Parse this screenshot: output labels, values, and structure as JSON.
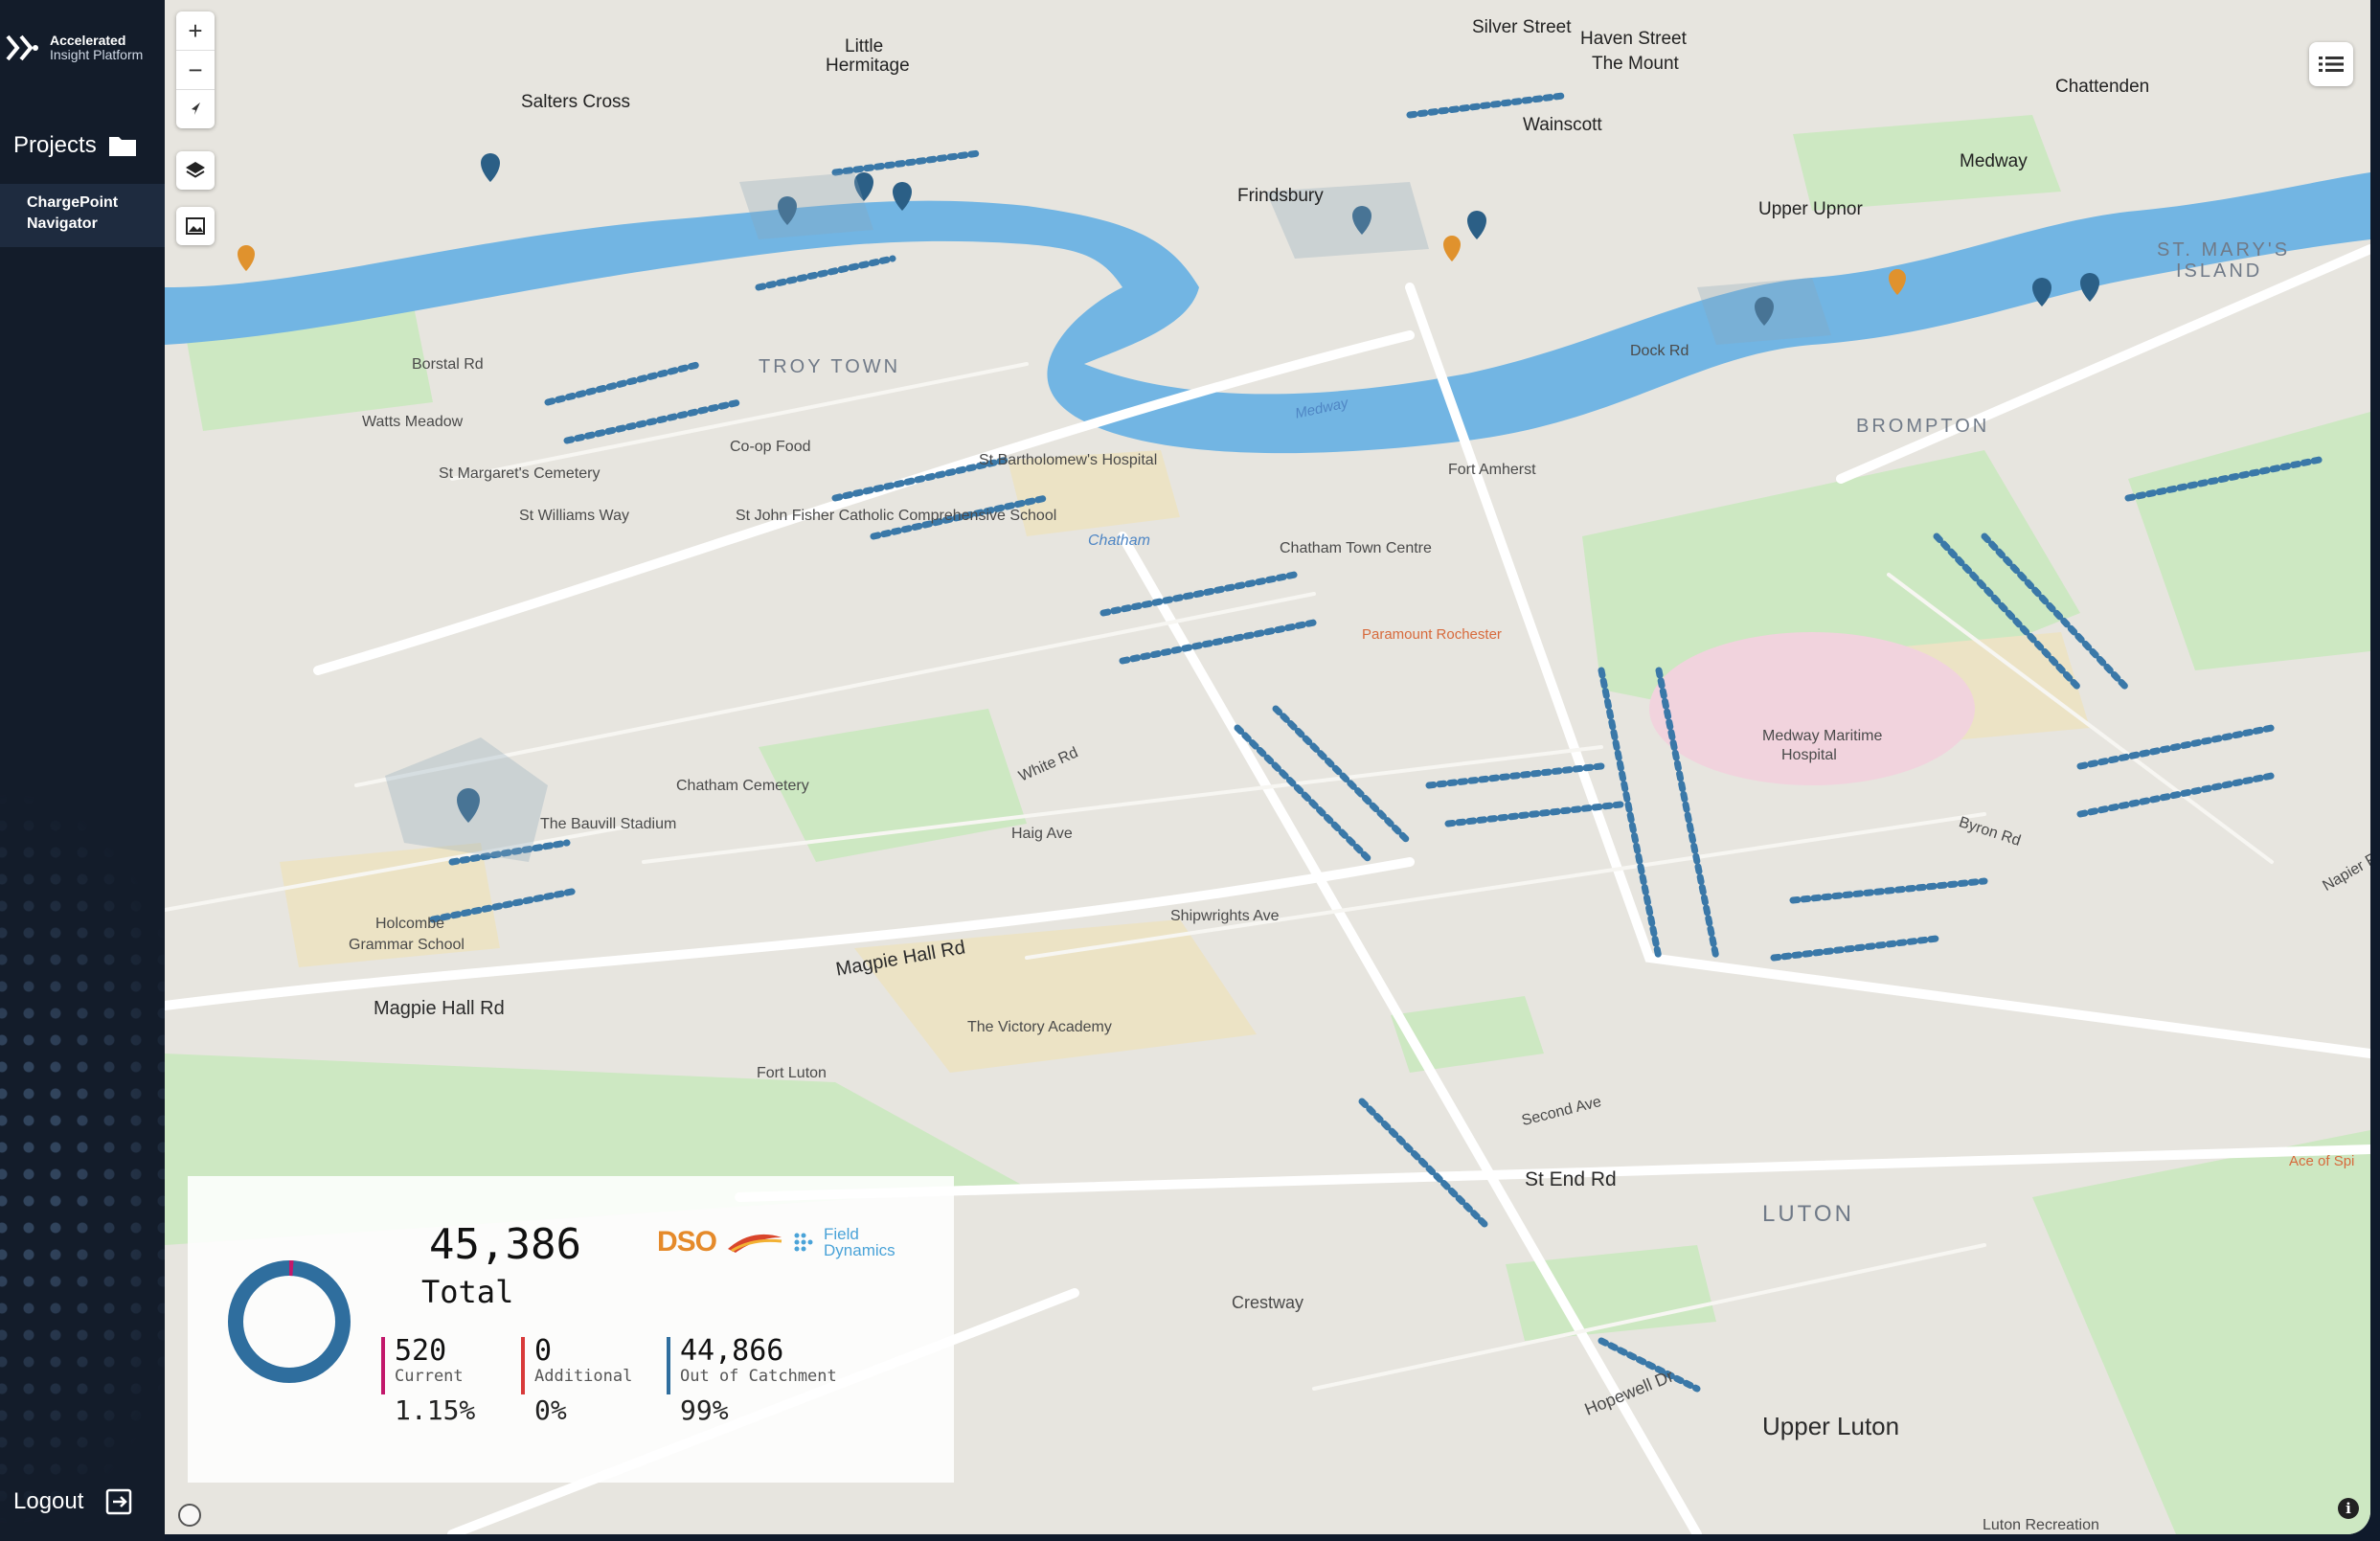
{
  "app": {
    "logo_line1": "Accelerated",
    "logo_line2": "Insight Platform"
  },
  "sidebar": {
    "projects_label": "Projects",
    "project_line1": "ChargePoint",
    "project_line2": "Navigator",
    "logout_label": "Logout"
  },
  "map": {
    "controls": {
      "zoom_in": "+",
      "zoom_out": "−"
    },
    "labels": {
      "little_hermitage_1": "Little",
      "little_hermitage_2": "Hermitage",
      "salters_cross": "Salters Cross",
      "silver_street": "Silver Street",
      "haven_street": "Haven Street",
      "the_mount": "The Mount",
      "chattenden": "Chattenden",
      "wainscott": "Wainscott",
      "medway_top": "Medway",
      "frindsbury": "Frindsbury",
      "upper_upnor": "Upper Upnor",
      "st_marys_island_1": "ST. MARY'S",
      "st_marys_island_2": "ISLAND",
      "troy_town": "TROY TOWN",
      "brompton": "BROMPTON",
      "borstal_rd": "Borstal Rd",
      "dock_rd": "Dock Rd",
      "watts_meadow": "Watts Meadow",
      "st_margarets_cemetery": "St Margaret's Cemetery",
      "co_op_food": "Co-op Food",
      "st_williams_way": "St Williams Way",
      "st_bartholomews": "St Bartholomew's Hospital",
      "st_john_fisher": "St John Fisher Catholic Comprehensive School",
      "chatham": "Chatham",
      "chatham_town_centre": "Chatham Town Centre",
      "fort_amherst": "Fort Amherst",
      "medway_maritime_1": "Medway Maritime",
      "medway_maritime_2": "Hospital",
      "chatham_cemetery": "Chatham Cemetery",
      "bauvill_stadium": "The Bauvill Stadium",
      "holcombe_1": "Holcombe",
      "holcombe_2": "Grammar School",
      "magpie_hall_rd": "Magpie Hall Rd",
      "magpie_hall_rd_2": "Magpie Hall Rd",
      "victory_academy": "The Victory Academy",
      "fort_luton": "Fort Luton",
      "shipwrights_ave": "Shipwrights Ave",
      "second_ave": "Second Ave",
      "st_end_rd": "St End Rd",
      "luton": "LUTON",
      "crestway": "Crestway",
      "hopewell_dr": "Hopewell Dr",
      "upper_luton": "Upper Luton",
      "luton_recreation": "Luton Recreation",
      "byron_rd": "Byron Rd",
      "napier_rd": "Napier Rd",
      "haig_ave": "Haig Ave",
      "white_rd": "White Rd",
      "medway_river": "Medway",
      "paramount_rochester": "Paramount Rochester",
      "ace_of_spades": "Ace of Spi"
    }
  },
  "stats": {
    "total_value": "45,386",
    "total_label": "Total",
    "current": {
      "value": "520",
      "label": "Current",
      "pct": "1.15%",
      "color": "#c2186b",
      "fraction": 0.0115
    },
    "additional": {
      "value": "0",
      "label": "Additional",
      "pct": "0%",
      "color": "#d83a3a",
      "fraction": 0
    },
    "out_of_catchment": {
      "value": "44,866",
      "label": "Out of Catchment",
      "pct": "99%",
      "color": "#2f6e9e",
      "fraction": 0.99
    },
    "brand_dso": "DSO",
    "brand_fd_1": "Field",
    "brand_fd_2": "Dynamics"
  }
}
